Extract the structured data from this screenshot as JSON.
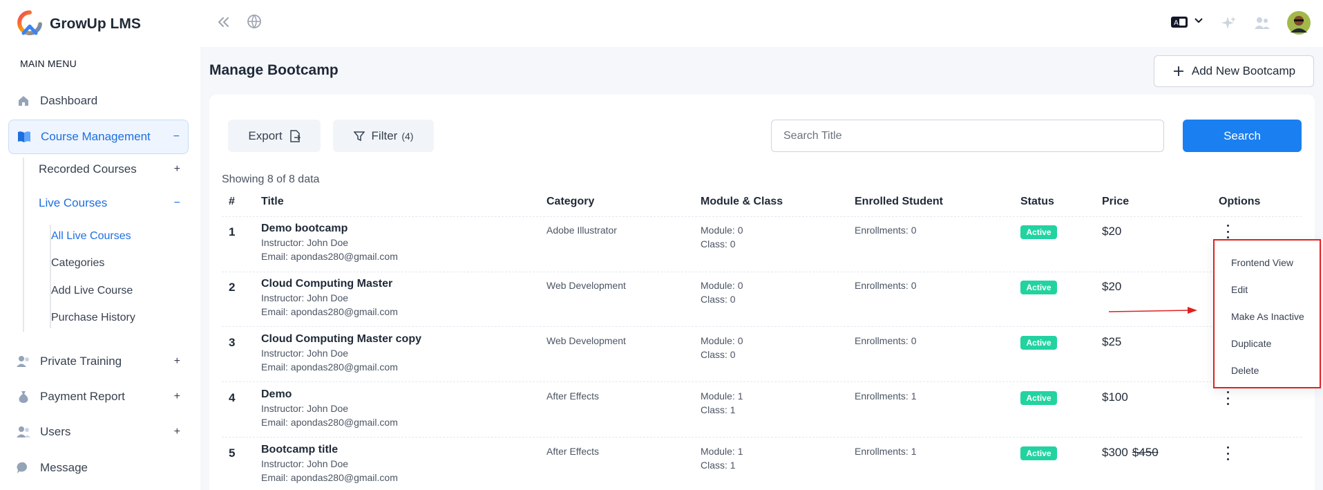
{
  "brand": {
    "name": "GrowUp LMS"
  },
  "sidebar": {
    "section_label": "MAIN MENU",
    "items": [
      {
        "label": "Dashboard",
        "icon": "home-icon",
        "toggle": ""
      },
      {
        "label": "Course Management",
        "icon": "book-icon",
        "toggle": "−"
      },
      {
        "label": "Private Training",
        "icon": "users-icon",
        "toggle": "+"
      },
      {
        "label": "Payment Report",
        "icon": "money-bag-icon",
        "toggle": "+"
      },
      {
        "label": "Users",
        "icon": "user-group-icon",
        "toggle": "+"
      },
      {
        "label": "Message",
        "icon": "chat-icon",
        "toggle": ""
      }
    ],
    "course_sub": [
      {
        "label": "Recorded Courses",
        "toggle": "+"
      },
      {
        "label": "Live Courses",
        "toggle": "−"
      }
    ],
    "live_sub": [
      "All Live Courses",
      "Categories",
      "Add Live Course",
      "Purchase History"
    ]
  },
  "page": {
    "title": "Manage Bootcamp",
    "add_button": "Add New Bootcamp",
    "export_label": "Export",
    "filter_label": "Filter",
    "filter_count": "(4)",
    "search_placeholder": "Search Title",
    "search_button": "Search",
    "showing": "Showing 8 of 8 data"
  },
  "table": {
    "headers": [
      "#",
      "Title",
      "Category",
      "Module & Class",
      "Enrolled Student",
      "Status",
      "Price",
      "Options"
    ],
    "rows": [
      {
        "idx": "1",
        "title": "Demo bootcamp",
        "instructor": "Instructor: John Doe",
        "email": "Email: apondas280@gmail.com",
        "category": "Adobe Illustrator",
        "module": "Module: 0",
        "class": "Class: 0",
        "enroll": "Enrollments: 0",
        "status": "Active",
        "price": "$20",
        "old_price": ""
      },
      {
        "idx": "2",
        "title": "Cloud Computing Master",
        "instructor": "Instructor: John Doe",
        "email": "Email: apondas280@gmail.com",
        "category": "Web Development",
        "module": "Module: 0",
        "class": "Class: 0",
        "enroll": "Enrollments: 0",
        "status": "Active",
        "price": "$20",
        "old_price": ""
      },
      {
        "idx": "3",
        "title": "Cloud Computing Master copy",
        "instructor": "Instructor: John Doe",
        "email": "Email: apondas280@gmail.com",
        "category": "Web Development",
        "module": "Module: 0",
        "class": "Class: 0",
        "enroll": "Enrollments: 0",
        "status": "Active",
        "price": "$25",
        "old_price": ""
      },
      {
        "idx": "4",
        "title": "Demo",
        "instructor": "Instructor: John Doe",
        "email": "Email: apondas280@gmail.com",
        "category": "After Effects",
        "module": "Module: 1",
        "class": "Class: 1",
        "enroll": "Enrollments: 1",
        "status": "Active",
        "price": "$100",
        "old_price": ""
      },
      {
        "idx": "5",
        "title": "Bootcamp title",
        "instructor": "Instructor: John Doe",
        "email": "Email: apondas280@gmail.com",
        "category": "After Effects",
        "module": "Module: 1",
        "class": "Class: 1",
        "enroll": "Enrollments: 1",
        "status": "Active",
        "price": "$300",
        "old_price": "$450"
      }
    ]
  },
  "dropdown": {
    "items": [
      "Frontend View",
      "Edit",
      "Make As Inactive",
      "Duplicate",
      "Delete"
    ]
  },
  "colors": {
    "accent": "#1a7ff0",
    "active_badge": "#22d3a0",
    "highlight": "#e02020"
  }
}
